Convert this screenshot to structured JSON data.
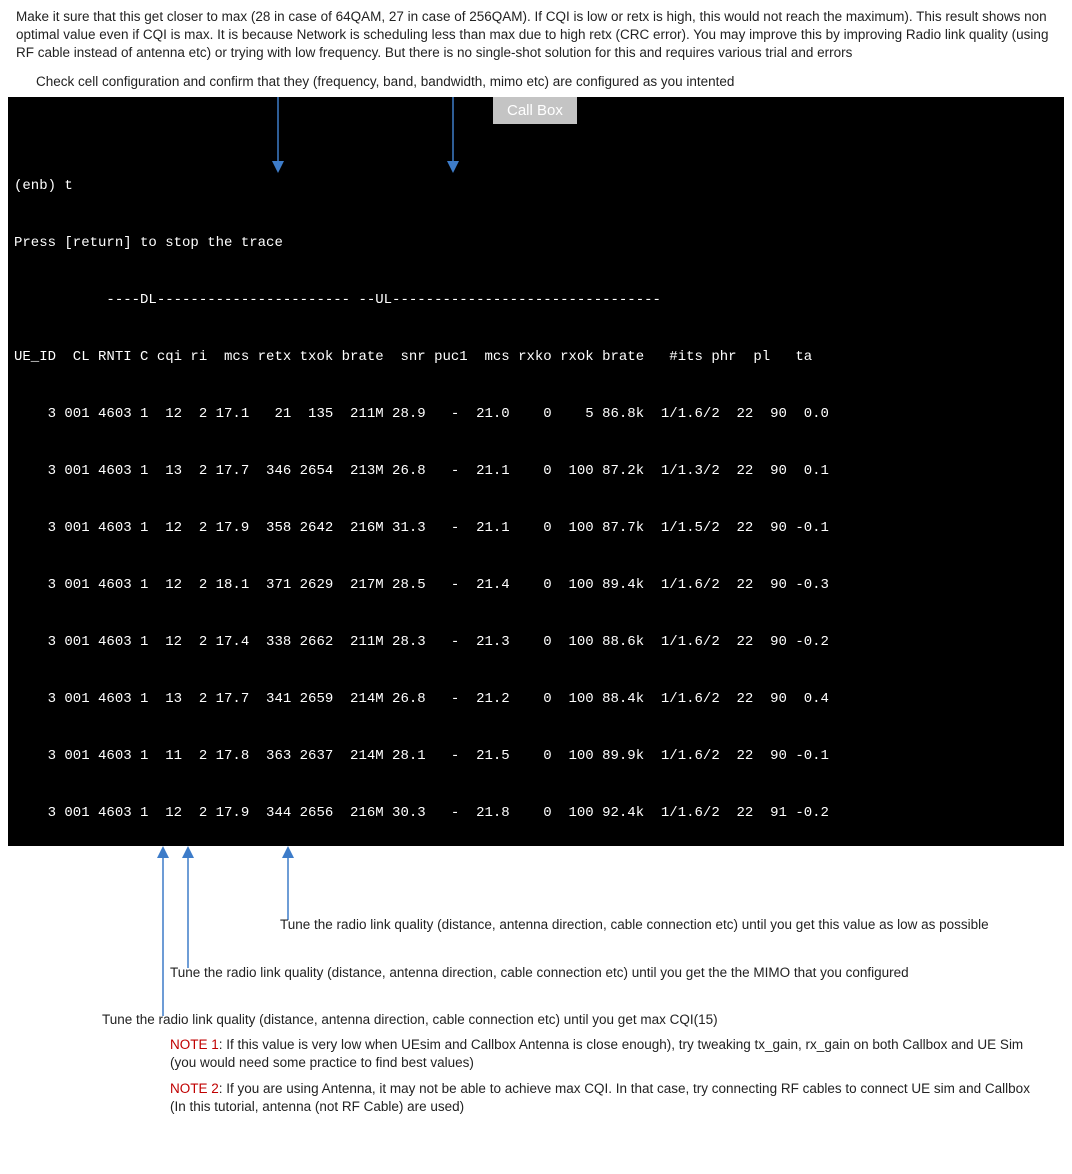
{
  "para_top": "Make it sure that this get closer to max (28 in case of 64QAM, 27 in case of 256QAM). If CQI is low or retx is high, this would not reach the maximum). This result shows non optimal value even if CQI is max. It is because Network is scheduling less than max due to high retx (CRC error). You may improve this by improving Radio link quality (using RF cable instead of antenna etc) or trying with low frequency. But there is no single-shot solution for this and requires various trial and errors",
  "para_check": "Check cell configuration and confirm that they (frequency, band, bandwidth, mimo etc) are configured as you intented",
  "callbox_label": "Call Box",
  "terminal": {
    "line1": "(enb) t",
    "line2": "Press [return] to stop the trace",
    "line3": "           ----DL----------------------- --UL--------------------------------",
    "header": "UE_ID  CL RNTI C cqi ri  mcs retx txok brate  snr puc1  mcs rxko rxok brate   #its phr  pl   ta",
    "rows": [
      "    3 001 4603 1  12  2 17.1   21  135  211M 28.9   -  21.0    0    5 86.8k  1/1.6/2  22  90  0.0",
      "    3 001 4603 1  13  2 17.7  346 2654  213M 26.8   -  21.1    0  100 87.2k  1/1.3/2  22  90  0.1",
      "    3 001 4603 1  12  2 17.9  358 2642  216M 31.3   -  21.1    0  100 87.7k  1/1.5/2  22  90 -0.1",
      "    3 001 4603 1  12  2 18.1  371 2629  217M 28.5   -  21.4    0  100 89.4k  1/1.6/2  22  90 -0.3",
      "    3 001 4603 1  12  2 17.4  338 2662  211M 28.3   -  21.3    0  100 88.6k  1/1.6/2  22  90 -0.2",
      "    3 001 4603 1  13  2 17.7  341 2659  214M 26.8   -  21.2    0  100 88.4k  1/1.6/2  22  90  0.4",
      "    3 001 4603 1  11  2 17.8  363 2637  214M 28.1   -  21.5    0  100 89.9k  1/1.6/2  22  90 -0.1",
      "    3 001 4603 1  12  2 17.9  344 2656  216M 30.3   -  21.8    0  100 92.4k  1/1.6/2  22  91 -0.2"
    ]
  },
  "tune3": "Tune the radio link quality (distance, antenna direction, cable connection etc) until you get this value as low as possible",
  "tune2": "Tune the radio link quality (distance, antenna direction, cable connection etc) until you get the the MIMO that you configured",
  "tune1": "Tune the radio link quality (distance, antenna direction, cable connection etc) until you get max CQI(15)",
  "note1_label": "NOTE 1",
  "note1_text": ": If this value is very low when UEsim and Callbox Antenna is close enough), try tweaking tx_gain, rx_gain on both Callbox and UE Sim (you would need some practice to find best values)",
  "note2_label": "NOTE 2",
  "note2_text": ": If you are using Antenna, it may not be able to achieve max CQI. In that case, try connecting RF cables to connect UE sim and Callbox (In this tutorial, antenna (not RF Cable) are used)",
  "chart_data": {
    "type": "table",
    "note": "eNB trace output (monospace terminal table)",
    "columns": [
      "UE_ID",
      "CL",
      "RNTI",
      "C",
      "cqi",
      "ri",
      "mcs_dl",
      "retx",
      "txok",
      "brate_dl",
      "snr",
      "puc1",
      "mcs_ul",
      "rxko",
      "rxok",
      "brate_ul",
      "#its",
      "phr",
      "pl",
      "ta"
    ],
    "rows": [
      [
        3,
        "001",
        4603,
        1,
        12,
        2,
        17.1,
        21,
        135,
        "211M",
        28.9,
        "-",
        21.0,
        0,
        5,
        "86.8k",
        "1/1.6/2",
        22,
        90,
        0.0
      ],
      [
        3,
        "001",
        4603,
        1,
        13,
        2,
        17.7,
        346,
        2654,
        "213M",
        26.8,
        "-",
        21.1,
        0,
        100,
        "87.2k",
        "1/1.3/2",
        22,
        90,
        0.1
      ],
      [
        3,
        "001",
        4603,
        1,
        12,
        2,
        17.9,
        358,
        2642,
        "216M",
        31.3,
        "-",
        21.1,
        0,
        100,
        "87.7k",
        "1/1.5/2",
        22,
        90,
        -0.1
      ],
      [
        3,
        "001",
        4603,
        1,
        12,
        2,
        18.1,
        371,
        2629,
        "217M",
        28.5,
        "-",
        21.4,
        0,
        100,
        "89.4k",
        "1/1.6/2",
        22,
        90,
        -0.3
      ],
      [
        3,
        "001",
        4603,
        1,
        12,
        2,
        17.4,
        338,
        2662,
        "211M",
        28.3,
        "-",
        21.3,
        0,
        100,
        "88.6k",
        "1/1.6/2",
        22,
        90,
        -0.2
      ],
      [
        3,
        "001",
        4603,
        1,
        13,
        2,
        17.7,
        341,
        2659,
        "214M",
        26.8,
        "-",
        21.2,
        0,
        100,
        "88.4k",
        "1/1.6/2",
        22,
        90,
        0.4
      ],
      [
        3,
        "001",
        4603,
        1,
        11,
        2,
        17.8,
        363,
        2637,
        "214M",
        28.1,
        "-",
        21.5,
        0,
        100,
        "89.9k",
        "1/1.6/2",
        22,
        90,
        -0.1
      ],
      [
        3,
        "001",
        4603,
        1,
        12,
        2,
        17.9,
        344,
        2656,
        "216M",
        30.3,
        "-",
        21.8,
        0,
        100,
        "92.4k",
        "1/1.6/2",
        22,
        91,
        -0.2
      ]
    ]
  }
}
